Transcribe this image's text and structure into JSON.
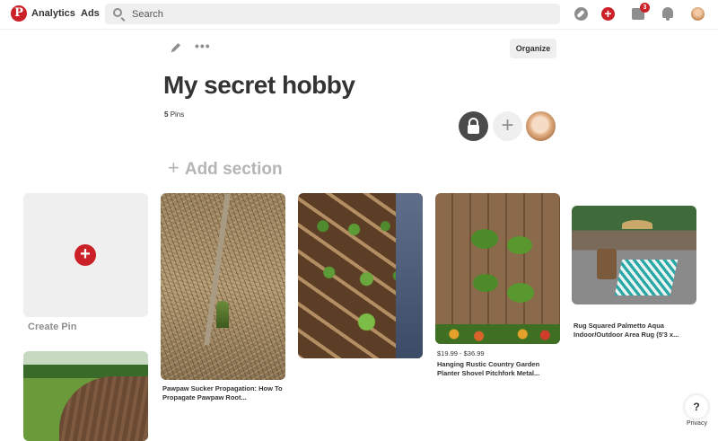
{
  "nav": {
    "logo_letter": "P",
    "analytics": "Analytics",
    "ads": "Ads",
    "search_placeholder": "Search",
    "notification_count": "3",
    "accent_color": "#cb2027"
  },
  "board": {
    "title": "My secret hobby",
    "pin_count": "5",
    "pins_label": "Pins",
    "organize_label": "Organize",
    "more_label": "•••",
    "add_section": "Add section",
    "add_section_plus": "+",
    "add_collaborator_plus": "+"
  },
  "create_pin": {
    "plus": "+",
    "label": "Create Pin"
  },
  "pins": [
    {
      "title": "Pawpaw Sucker Propagation: How To Propagate Pawpaw Root..."
    },
    {
      "title": ""
    },
    {
      "price": "$19.99 - $36.99",
      "title": "Hanging Rustic Country Garden Planter Shovel Pitchfork Metal..."
    },
    {
      "title": "Rug Squared Palmetto Aqua Indoor/Outdoor Area Rug (5'3 x..."
    },
    {
      "title": ""
    }
  ],
  "footer": {
    "help": "?",
    "privacy": "Privacy"
  },
  "icons": [
    "pinterest-logo-icon",
    "search-icon",
    "compass-icon",
    "create-plus-icon",
    "inbox-icon",
    "bell-icon",
    "pencil-icon",
    "lock-icon"
  ]
}
